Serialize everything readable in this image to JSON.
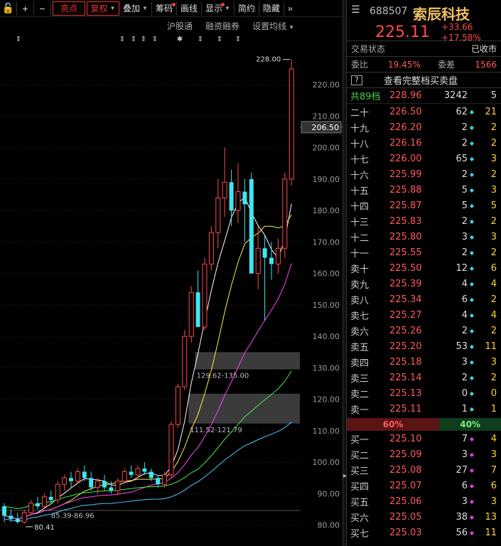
{
  "toolbar": {
    "lock_icon": "lock-icon",
    "plus": "+",
    "minus": "−",
    "highlight": "亮点",
    "adjust": "复权",
    "overlay": "叠加",
    "chips": "筹码",
    "draw": "画线",
    "display": "显示",
    "simple": "简约",
    "hide": "隐藏",
    "more": "»"
  },
  "subbar": {
    "hgt": "沪股通",
    "margin": "融资融券",
    "ma_setting": "设置均线"
  },
  "stock": {
    "code": "688507",
    "name": "索辰科技",
    "price": "225.11",
    "change": "+33.66",
    "change_pct": "+17.58%"
  },
  "status": {
    "label": "交易状态",
    "value": "已收市"
  },
  "weibi": {
    "label": "委比",
    "value": "19.45%",
    "diff_label": "委差",
    "diff_value": "1566"
  },
  "book_button": {
    "q": "?",
    "label": "查看完整档买卖盘"
  },
  "total_row": {
    "level": "共89档",
    "price": "228.96",
    "vol": "3242",
    "count": "5"
  },
  "sell_rows": [
    {
      "level": "二十",
      "price": "226.50",
      "vol": "62",
      "mark": "◆",
      "mark_color": "#3dd6e8",
      "count": "21"
    },
    {
      "level": "十九",
      "price": "226.20",
      "vol": "2",
      "mark": "◆",
      "mark_color": "#3dd6e8",
      "count": "2"
    },
    {
      "level": "十八",
      "price": "226.16",
      "vol": "2",
      "mark": "◆",
      "mark_color": "#3dd6e8",
      "count": "2"
    },
    {
      "level": "十七",
      "price": "226.00",
      "vol": "65",
      "mark": "◆",
      "mark_color": "#3dd6e8",
      "count": "3"
    },
    {
      "level": "十六",
      "price": "225.99",
      "vol": "2",
      "mark": "◆",
      "mark_color": "#3dd6e8",
      "count": "2"
    },
    {
      "level": "十五",
      "price": "225.88",
      "vol": "5",
      "mark": "◆",
      "mark_color": "#3dd6e8",
      "count": "3"
    },
    {
      "level": "十四",
      "price": "225.87",
      "vol": "5",
      "mark": "◆",
      "mark_color": "#3dd6e8",
      "count": "5"
    },
    {
      "level": "十三",
      "price": "225.83",
      "vol": "2",
      "mark": "◆",
      "mark_color": "#3dd6e8",
      "count": "2"
    },
    {
      "level": "十二",
      "price": "225.80",
      "vol": "3",
      "mark": "◆",
      "mark_color": "#3dd6e8",
      "count": "3"
    },
    {
      "level": "十一",
      "price": "225.55",
      "vol": "2",
      "mark": "◆",
      "mark_color": "#3dd6e8",
      "count": "2"
    },
    {
      "level": "卖十",
      "price": "225.50",
      "vol": "12",
      "mark": "◆",
      "mark_color": "#3dd6e8",
      "count": "6"
    },
    {
      "level": "卖九",
      "price": "225.39",
      "vol": "4",
      "mark": "◆",
      "mark_color": "#3dd6e8",
      "count": "4"
    },
    {
      "level": "卖八",
      "price": "225.34",
      "vol": "6",
      "mark": "◆",
      "mark_color": "#3dd6e8",
      "count": "2"
    },
    {
      "level": "卖七",
      "price": "225.27",
      "vol": "4",
      "mark": "◆",
      "mark_color": "#3dd6e8",
      "count": "4"
    },
    {
      "level": "卖六",
      "price": "225.26",
      "vol": "2",
      "mark": "◆",
      "mark_color": "#3dd6e8",
      "count": "2"
    },
    {
      "level": "卖五",
      "price": "225.20",
      "vol": "53",
      "mark": "◆",
      "mark_color": "#3dd6e8",
      "count": "11"
    },
    {
      "level": "卖四",
      "price": "225.18",
      "vol": "3",
      "mark": "◆",
      "mark_color": "#3dd6e8",
      "count": "3"
    },
    {
      "level": "卖三",
      "price": "225.14",
      "vol": "2",
      "mark": "◆",
      "mark_color": "#3dd6e8",
      "count": "2"
    },
    {
      "level": "卖二",
      "price": "225.13",
      "vol": "0",
      "mark": "◆",
      "mark_color": "#3dd6e8",
      "count": "0"
    },
    {
      "level": "卖一",
      "price": "225.11",
      "vol": "1",
      "mark": "◆",
      "mark_color": "#3dd6e8",
      "count": "1"
    }
  ],
  "ratio": {
    "sell": "60%",
    "buy": "40%",
    "sell_frac": 0.6
  },
  "buy_rows": [
    {
      "level": "买一",
      "price": "225.10",
      "vol": "7",
      "mark": "◆",
      "mark_color": "#e040e0",
      "count": "4"
    },
    {
      "level": "买二",
      "price": "225.09",
      "vol": "3",
      "mark": "◆",
      "mark_color": "#e040e0",
      "count": "3"
    },
    {
      "level": "买三",
      "price": "225.08",
      "vol": "27",
      "mark": "◆",
      "mark_color": "#e040e0",
      "count": "7"
    },
    {
      "level": "买四",
      "price": "225.07",
      "vol": "6",
      "mark": "◆",
      "mark_color": "#e040e0",
      "count": "6"
    },
    {
      "level": "买五",
      "price": "225.06",
      "vol": "3",
      "mark": "◆",
      "mark_color": "#e040e0",
      "count": "3"
    },
    {
      "level": "买六",
      "price": "225.05",
      "vol": "38",
      "mark": "◆",
      "mark_color": "#e040e0",
      "count": "13"
    },
    {
      "level": "买七",
      "price": "225.03",
      "vol": "56",
      "mark": "◆",
      "mark_color": "#e040e0",
      "count": "11"
    }
  ],
  "chart_data": {
    "type": "candlestick",
    "y_axis_ticks": [
      80,
      90,
      100,
      110,
      120,
      130,
      140,
      150,
      160,
      170,
      180,
      190,
      200,
      210,
      220
    ],
    "y_tick_labels": [
      "80.00",
      "90.00",
      "100.00",
      "110.00",
      "120.00",
      "130.00",
      "140.00",
      "150.00",
      "160.00",
      "170.00",
      "180.00",
      "190.00",
      "200.00",
      "210.00",
      "220.00"
    ],
    "ylim": [
      77,
      232
    ],
    "cursor_price": "206.50",
    "high_annotation": "228.00",
    "low_annotation": "80.41",
    "zones": [
      {
        "from": 129.5,
        "to": 135.0,
        "label": "129.62-135.00"
      },
      {
        "from": 112.3,
        "to": 121.8,
        "label": "111.52-121.79"
      },
      {
        "from": 85,
        "to": 86.96,
        "label": "85.39-86.96"
      }
    ],
    "candles": [
      [
        86,
        87,
        81,
        83
      ],
      [
        83,
        85,
        81,
        82
      ],
      [
        82,
        84,
        80.5,
        81
      ],
      [
        81,
        85,
        80.4,
        84
      ],
      [
        84,
        88,
        83,
        87
      ],
      [
        87,
        89,
        85,
        86
      ],
      [
        86,
        90,
        85,
        89
      ],
      [
        89,
        91,
        87,
        88
      ],
      [
        88,
        94,
        87,
        93
      ],
      [
        93,
        96,
        91,
        95
      ],
      [
        95,
        97,
        92,
        94
      ],
      [
        94,
        98,
        93,
        97
      ],
      [
        97,
        99,
        94,
        95
      ],
      [
        95,
        97,
        91,
        92
      ],
      [
        92,
        95,
        90,
        94
      ],
      [
        94,
        96,
        91,
        92
      ],
      [
        92,
        94,
        90,
        91
      ],
      [
        91,
        95,
        90,
        94
      ],
      [
        94,
        98,
        93,
        97
      ],
      [
        97,
        99,
        95,
        96
      ],
      [
        96,
        99,
        95,
        98
      ],
      [
        98,
        100,
        96,
        97
      ],
      [
        97,
        98,
        94,
        95
      ],
      [
        95,
        96,
        92,
        93
      ],
      [
        93,
        97,
        92,
        96
      ],
      [
        96,
        113,
        95,
        112
      ],
      [
        112,
        125,
        111,
        124
      ],
      [
        124,
        142,
        123,
        140
      ],
      [
        140,
        156,
        138,
        154
      ],
      [
        154,
        161,
        143,
        143
      ],
      [
        143,
        165,
        142,
        163
      ],
      [
        163,
        175,
        161,
        173
      ],
      [
        173,
        190,
        168,
        184
      ],
      [
        184,
        200,
        178,
        189
      ],
      [
        189,
        193,
        175,
        180
      ],
      [
        180,
        195,
        176,
        186
      ],
      [
        186,
        190,
        170,
        182
      ],
      [
        190,
        192,
        160,
        160
      ],
      [
        160,
        175,
        155,
        168
      ],
      [
        168,
        172,
        145,
        165
      ],
      [
        165,
        170,
        158,
        163
      ],
      [
        163,
        171,
        160,
        168
      ],
      [
        168,
        192,
        165,
        190
      ],
      [
        190,
        228,
        188,
        225
      ]
    ],
    "ma_colors": [
      "#ffffff",
      "#ffee44",
      "#ff44ff",
      "#44ee44",
      "#4dc9ff"
    ]
  }
}
